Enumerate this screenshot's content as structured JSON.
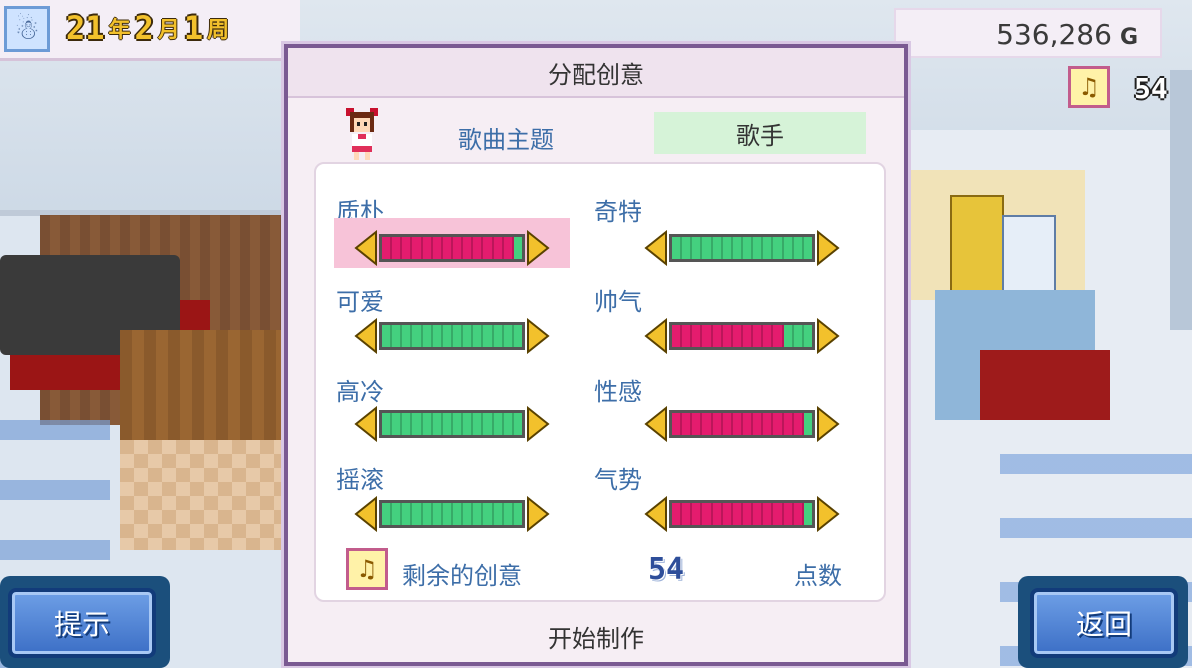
{
  "hud": {
    "year": "21",
    "year_unit": "年",
    "month": "2",
    "month_unit": "月",
    "week": "1",
    "week_unit": "周",
    "money": "536,286",
    "currency": "G",
    "idea_points": "54"
  },
  "dialog": {
    "title": "分配创意",
    "theme_label": "歌曲主题",
    "theme_value": "歌手",
    "attributes": [
      {
        "label": "质朴",
        "level": 0.93,
        "selected": true
      },
      {
        "label": "奇特",
        "level": 0.0,
        "selected": false
      },
      {
        "label": "可爱",
        "level": 0.0,
        "selected": false
      },
      {
        "label": "帅气",
        "level": 0.8,
        "selected": false
      },
      {
        "label": "高冷",
        "level": 0.0,
        "selected": false
      },
      {
        "label": "性感",
        "level": 0.93,
        "selected": false
      },
      {
        "label": "摇滚",
        "level": 0.0,
        "selected": false
      },
      {
        "label": "气势",
        "level": 0.93,
        "selected": false
      }
    ],
    "remaining_label": "剩余的创意",
    "remaining_count": "54",
    "remaining_unit": "点数",
    "start_label": "开始制作"
  },
  "buttons": {
    "hint_label": "提示",
    "back_label": "返回"
  },
  "icons": {
    "season": "snowman-icon",
    "idea": "gramophone-icon",
    "slider_left": "triangle-left-icon",
    "slider_right": "triangle-right-icon"
  },
  "colors": {
    "bar_filled": "#e41c6e",
    "bar_empty": "#44d07f",
    "label_blue": "#3d6ea8",
    "theme_value_bg": "#d6f3d8",
    "selected_bg": "#f7c3d8"
  }
}
